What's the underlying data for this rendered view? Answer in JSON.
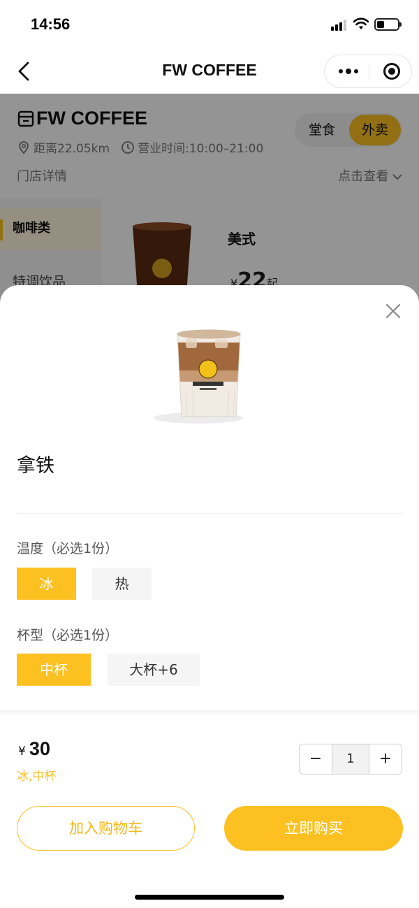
{
  "status_bar": {
    "time": "14:56",
    "battery_level": 0.35
  },
  "nav": {
    "title": "FW COFFEE",
    "back_icon": "chevron-left-icon",
    "more_icon": "more-dots-icon",
    "close_icon": "target-close-icon"
  },
  "store": {
    "name": "FW COFFEE",
    "distance": "距离22.05km",
    "hours": "营业时间:10:00–21:00",
    "detail_label": "门店详情",
    "view_label": "点击查看",
    "mode_dine_in": "堂食",
    "mode_delivery": "外卖",
    "selected_mode": "外卖"
  },
  "menu": {
    "categories": [
      {
        "label": "咖啡类"
      },
      {
        "label": "特调饮品"
      }
    ],
    "featured_product": {
      "name": "美式",
      "currency": "¥",
      "price": "22",
      "suffix": "起"
    }
  },
  "sheet": {
    "product_name": "拿铁",
    "options": [
      {
        "label": "温度（必选1份）",
        "choices": [
          {
            "label": "冰",
            "selected": true
          },
          {
            "label": "热",
            "selected": false
          }
        ]
      },
      {
        "label": "杯型（必选1份）",
        "choices": [
          {
            "label": "中杯",
            "selected": true
          },
          {
            "label": "大杯+6",
            "selected": false
          }
        ]
      }
    ],
    "currency": "¥",
    "price": "30",
    "selected_spec": "冰,中杯",
    "quantity": "1",
    "minus_label": "−",
    "plus_label": "+",
    "add_to_cart": "加入购物车",
    "buy_now": "立即购买"
  },
  "colors": {
    "accent": "#fcc020",
    "accent_text": "#fcbf25",
    "overlay": "rgba(0,0,0,0.42)"
  }
}
